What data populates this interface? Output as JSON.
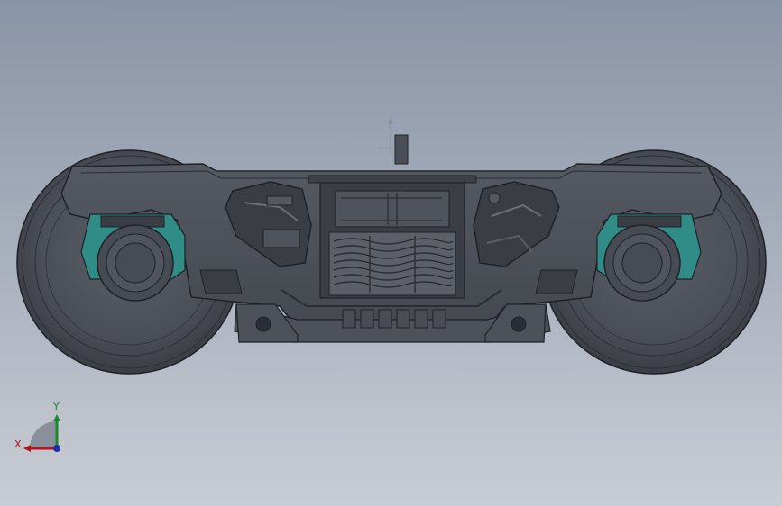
{
  "viewport": {
    "background_top": "#8994a6",
    "background_bottom": "#c8ccd4"
  },
  "model": {
    "body_color": "#4a4e57",
    "edge_color": "#1f2227",
    "highlight_color": "#5f636c",
    "bearing_adapter_color": "#2f8c86"
  },
  "triad": {
    "x_label": "X",
    "y_label": "Y",
    "x_color": "#b0161a",
    "y_color": "#1a8a2a",
    "z_color": "#1a2fb0"
  }
}
